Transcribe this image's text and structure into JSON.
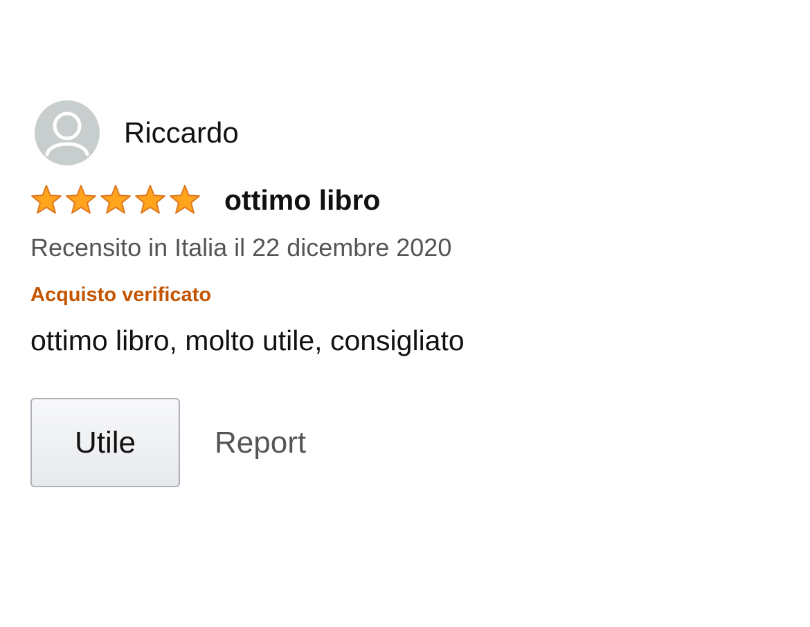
{
  "review": {
    "reviewer_name": "Riccardo",
    "avatar_icon": "user-silhouette-icon",
    "rating": 5,
    "rating_max": 5,
    "title": "ottimo libro",
    "date": "Recensito in Italia il 22 dicembre 2020",
    "verified_label": "Acquisto verificato",
    "body": "ottimo libro, molto utile, consigliato",
    "helpful_label": "Utile",
    "report_label": "Report"
  },
  "colors": {
    "star_fill": "#ffa41c",
    "star_stroke": "#de7921",
    "verified": "#c45500",
    "avatar_bg": "#c8cdcd"
  }
}
